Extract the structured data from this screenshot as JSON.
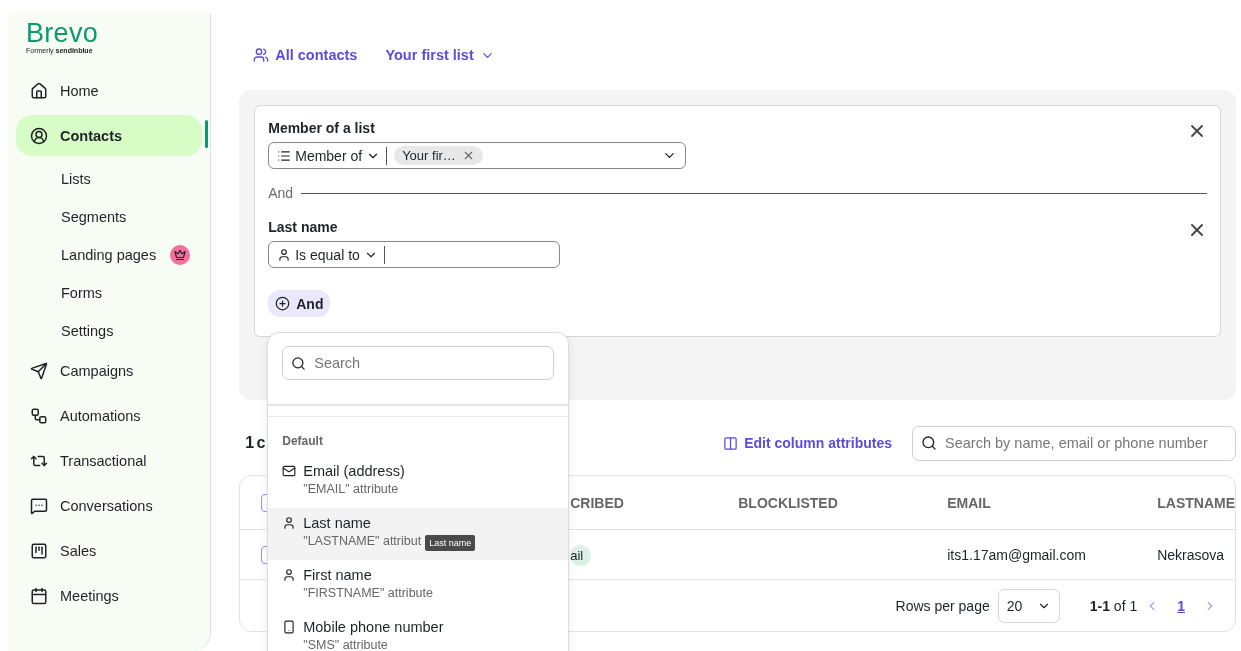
{
  "sidebar": {
    "logo": "Brevo",
    "tagline_prefix": "Formerly",
    "tagline_brand": "sendinblue",
    "items": [
      {
        "label": "Home",
        "selected": false
      },
      {
        "label": "Contacts",
        "selected": true,
        "children": [
          {
            "label": "Lists",
            "premium": false
          },
          {
            "label": "Segments",
            "premium": false
          },
          {
            "label": "Landing pages",
            "premium": true
          },
          {
            "label": "Forms",
            "premium": false
          },
          {
            "label": "Settings",
            "premium": false
          }
        ]
      },
      {
        "label": "Campaigns",
        "selected": false
      },
      {
        "label": "Automations",
        "selected": false
      },
      {
        "label": "Transactional",
        "selected": false
      },
      {
        "label": "Conversations",
        "selected": false
      },
      {
        "label": "Sales",
        "selected": false
      },
      {
        "label": "Meetings",
        "selected": false
      }
    ]
  },
  "nav": [
    {
      "label": "All contacts",
      "dropdown": false
    },
    {
      "label": "Your first list",
      "dropdown": true
    }
  ],
  "filters": {
    "groups": [
      {
        "title": "Member of a list",
        "kind": "list",
        "operator": "Member of",
        "chips": [
          "Your fir…"
        ]
      },
      {
        "title": "Last name",
        "kind": "text",
        "operator": "Is equal to"
      }
    ],
    "separator": "And",
    "add_button": "And"
  },
  "contacts": {
    "heading": "1 c",
    "edit_columns": "Edit column attributes",
    "search_placeholder": "Search by name, email or phone number",
    "header_checked": false,
    "columns": [
      "CRIBED",
      "BLOCKLISTED",
      "EMAIL",
      "LASTNAME"
    ],
    "rows": [
      {
        "checked": false,
        "status": "ail",
        "email": "its1.17am@gmail.com",
        "lastname": "Nekrasova"
      }
    ],
    "rows_per_page_label": "Rows per page",
    "rows_per_page": "20",
    "range": "**1-1** of 1",
    "pages": [
      {
        "label": "1",
        "selected": true
      }
    ]
  },
  "attribute_menu": {
    "search_placeholder": "Search",
    "section": "Default",
    "items": [
      {
        "label": "Email (address)",
        "sub": "\"EMAIL\" attribute",
        "hovered": false
      },
      {
        "label": "Last name",
        "sub": "\"LASTNAME\" attribut",
        "hovered": true
      },
      {
        "label": "First name",
        "sub": "\"FIRSTNAME\" attribute",
        "hovered": false
      },
      {
        "label": "Mobile phone number",
        "sub": "\"SMS\" attribute",
        "hovered": false
      }
    ],
    "tooltip": "Last name"
  }
}
